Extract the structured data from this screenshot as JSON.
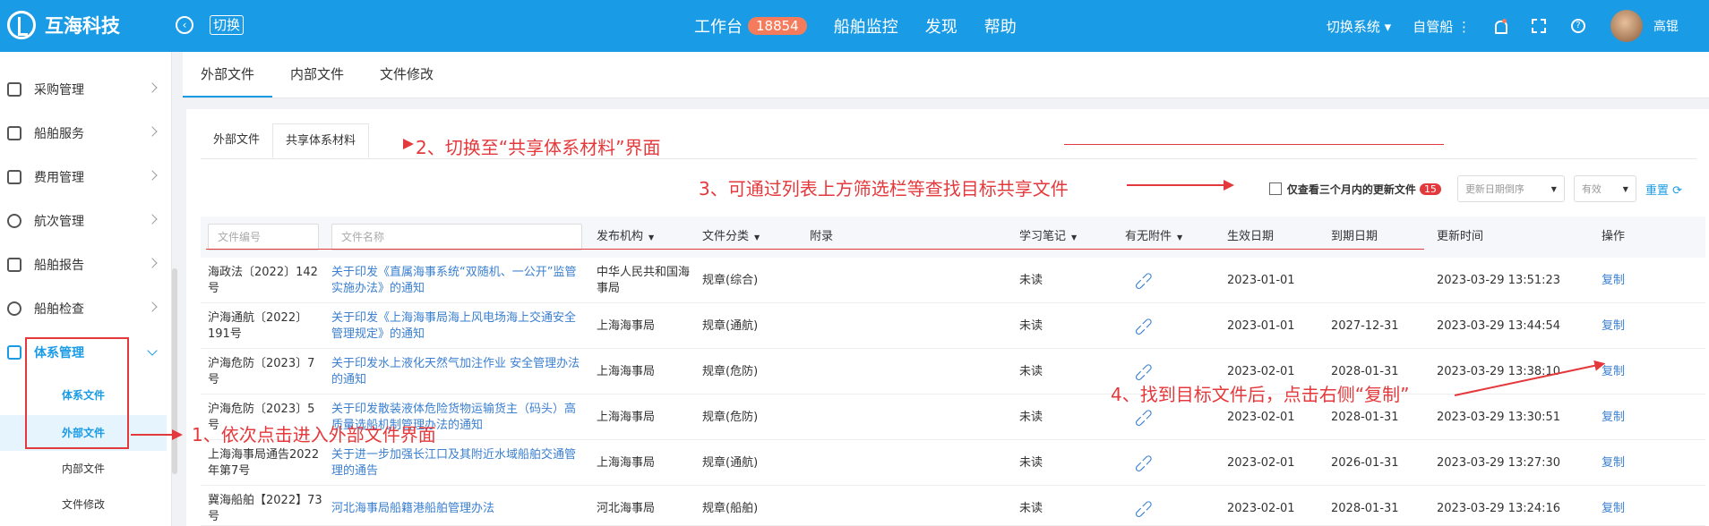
{
  "header": {
    "brand": "互海科技",
    "switch_label": "切换",
    "nav": [
      {
        "label": "工作台",
        "badge": "18854"
      },
      {
        "label": "船舶监控"
      },
      {
        "label": "发现"
      },
      {
        "label": "帮助"
      }
    ],
    "switch_system": "切换系统 ▾",
    "own_ships": "自管船 ⋮",
    "user": "高锟"
  },
  "sidebar": {
    "items": [
      {
        "label": "采购管理",
        "icon": "cart-icon"
      },
      {
        "label": "船舶服务",
        "icon": "roller-icon"
      },
      {
        "label": "费用管理",
        "icon": "coins-icon"
      },
      {
        "label": "航次管理",
        "icon": "globe-icon"
      },
      {
        "label": "船舶报告",
        "icon": "calendar-icon"
      },
      {
        "label": "船舶检查",
        "icon": "check-circle-icon"
      }
    ],
    "active_group": "体系管理",
    "sub_group": "体系文件",
    "sub_items": [
      "外部文件",
      "内部文件",
      "文件修改"
    ]
  },
  "main": {
    "top_tabs": [
      "外部文件",
      "内部文件",
      "文件修改"
    ],
    "sub_tabs": [
      "外部文件",
      "共享体系材料"
    ],
    "filters": {
      "recent_label": "仅查看三个月内的更新文件",
      "recent_count": "15",
      "sort_placeholder": "更新日期倒序",
      "status_placeholder": "有效",
      "reset_label": "重置"
    },
    "table": {
      "headers": {
        "doc_no_placeholder": "文件编号",
        "doc_name_placeholder": "文件名称",
        "issuer": "发布机构",
        "category": "文件分类",
        "appendix": "附录",
        "notes": "学习笔记",
        "attachment": "有无附件",
        "effective": "生效日期",
        "expiry": "到期日期",
        "updated": "更新时间",
        "action": "操作"
      },
      "rows": [
        {
          "no": "海政法〔2022〕142号",
          "name": "关于印发《直属海事系统“双随机、一公开”监管实施办法》的通知",
          "issuer": "中华人民共和国海事局",
          "category": "规章(综合)",
          "notes": "未读",
          "effective": "2023-01-01",
          "expiry": "",
          "updated": "2023-03-29 13:51:23",
          "action": "复制"
        },
        {
          "no": "沪海通航〔2022〕191号",
          "name": "关于印发《上海海事局海上风电场海上交通安全管理规定》的通知",
          "issuer": "上海海事局",
          "category": "规章(通航)",
          "notes": "未读",
          "effective": "2023-01-01",
          "expiry": "2027-12-31",
          "updated": "2023-03-29 13:44:54",
          "action": "复制"
        },
        {
          "no": "沪海危防〔2023〕7号",
          "name": "关于印发水上液化天然气加注作业 安全管理办法的通知",
          "issuer": "上海海事局",
          "category": "规章(危防)",
          "notes": "未读",
          "effective": "2023-02-01",
          "expiry": "2028-01-31",
          "updated": "2023-03-29 13:38:10",
          "action": "复制"
        },
        {
          "no": "沪海危防〔2023〕5号",
          "name": "关于印发散装液体危险货物运输货主（码头）高质量选船机制管理办法的通知",
          "issuer": "上海海事局",
          "category": "规章(危防)",
          "notes": "未读",
          "effective": "2023-02-01",
          "expiry": "2028-01-31",
          "updated": "2023-03-29 13:30:51",
          "action": "复制"
        },
        {
          "no": "上海海事局通告2022年第7号",
          "name": "关于进一步加强长江口及其附近水域船舶交通管理的通告",
          "issuer": "上海海事局",
          "category": "规章(通航)",
          "notes": "未读",
          "effective": "2023-02-01",
          "expiry": "2026-01-31",
          "updated": "2023-03-29 13:27:30",
          "action": "复制"
        },
        {
          "no": "冀海船舶【2022】73号",
          "name": "河北海事局船籍港船舶管理办法",
          "issuer": "河北海事局",
          "category": "规章(船舶)",
          "notes": "未读",
          "effective": "2023-02-01",
          "expiry": "2028-01-31",
          "updated": "2023-03-29 13:24:16",
          "action": "复制"
        }
      ]
    }
  },
  "annotations": {
    "step1": "1、依次点击进入外部文件界面",
    "step2": "2、切换至“共享体系材料”界面",
    "step3": "3、可通过列表上方筛选栏等查找目标共享文件",
    "step4": "4、找到目标文件后，点击右侧“复制”"
  },
  "colors": {
    "primary": "#1a9be6",
    "annotation": "#e4393c",
    "badge": "#f47c5c"
  }
}
